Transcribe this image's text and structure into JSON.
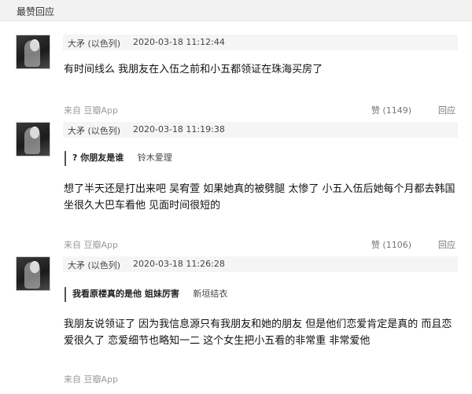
{
  "section_title": "最赞回应",
  "comments": [
    {
      "user": "大矛 (以色列)",
      "time": "2020-03-18 11:12:44",
      "quote": null,
      "text": "有时间线么 我朋友在入伍之前和小五都领证在珠海买房了",
      "from": "来自 豆瓣App",
      "likes": "赞 (1149)",
      "reply": "回应"
    },
    {
      "user": "大矛 (以色列)",
      "time": "2020-03-18 11:19:38",
      "quote": {
        "text": "? 你朋友是谁",
        "user": "铃木爱理"
      },
      "text": "想了半天还是打出来吧 吴宥萱 如果她真的被劈腿 太惨了 小五入伍后她每个月都去韩国坐很久大巴车看他 见面时间很短的",
      "from": "来自 豆瓣App",
      "likes": "赞 (1106)",
      "reply": "回应"
    },
    {
      "user": "大矛 (以色列)",
      "time": "2020-03-18 11:26:28",
      "quote": {
        "text": "我看原楼真的是他 姐妹厉害",
        "user": "新垣结衣"
      },
      "text": "我朋友说领证了 因为我信息源只有我朋友和她的朋友 但是他们恋爱肯定是真的 而且恋爱很久了 恋爱细节也略知一二 这个女生把小五看的非常重 非常爱他",
      "from": "来自 豆瓣App",
      "likes": "",
      "reply": ""
    }
  ]
}
